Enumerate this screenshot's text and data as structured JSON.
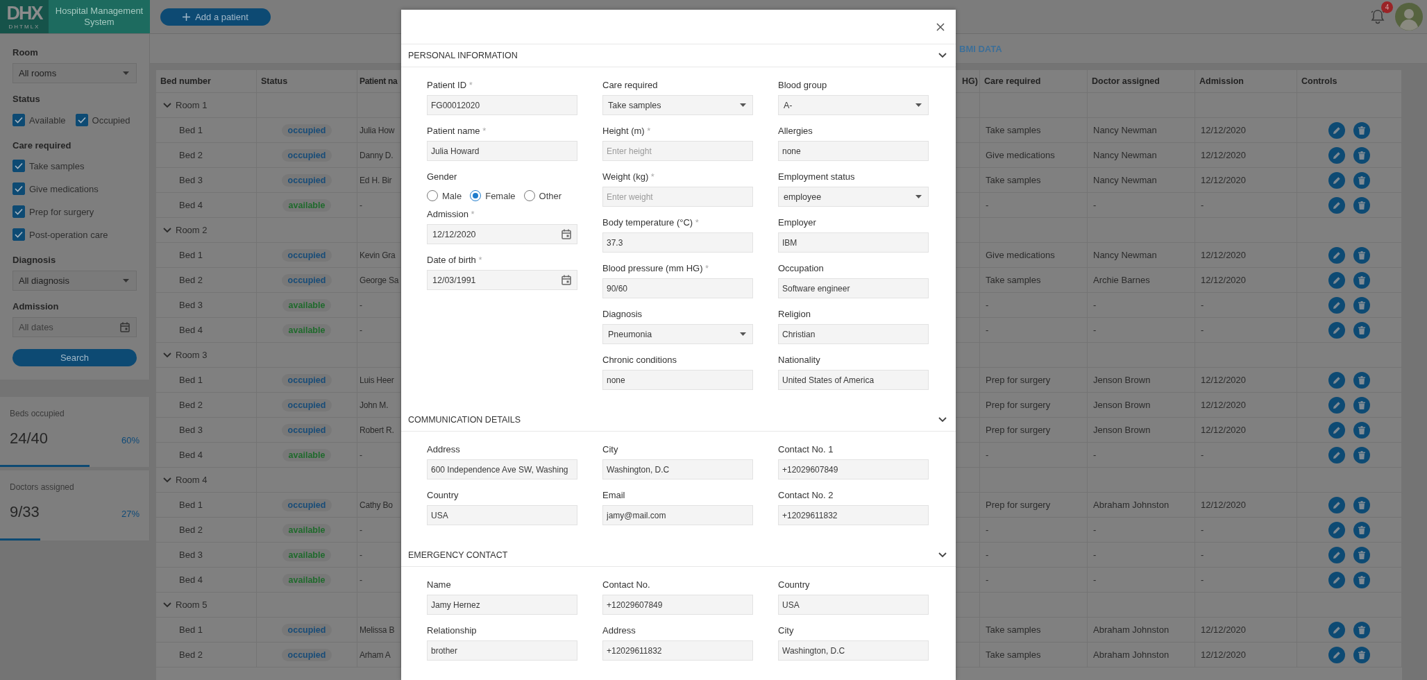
{
  "header": {
    "logo": "DHX",
    "logo_sub": "DHTMLX",
    "title": "Hospital Management System",
    "add_button": "Add a patient",
    "notification_count": "4"
  },
  "sidebar": {
    "room": {
      "label": "Room",
      "value": "All rooms"
    },
    "status": {
      "label": "Status",
      "options": [
        {
          "label": "Available",
          "checked": true
        },
        {
          "label": "Occupied",
          "checked": true
        }
      ]
    },
    "care": {
      "label": "Care required",
      "options": [
        {
          "label": "Take samples",
          "checked": true
        },
        {
          "label": "Give medications",
          "checked": true
        },
        {
          "label": "Prep for surgery",
          "checked": true
        },
        {
          "label": "Post-operation care",
          "checked": true
        }
      ]
    },
    "diagnosis": {
      "label": "Diagnosis",
      "value": "All diagnosis"
    },
    "admission": {
      "label": "Admission",
      "placeholder": "All dates"
    },
    "search_button": "Search"
  },
  "stats": [
    {
      "label": "Beds occupied",
      "value": "24/40",
      "percent": "60%",
      "level": 0.6
    },
    {
      "label": "Doctors assigned",
      "value": "9/33",
      "percent": "27%",
      "level": 0.27
    }
  ],
  "tabs": [
    {
      "label": "BMI DATA",
      "selected": false
    }
  ],
  "table": {
    "columns": [
      "Bed number",
      "Status",
      "Patient na",
      "HG)",
      "Care required",
      "Doctor assigned",
      "Admission",
      "Controls"
    ],
    "rooms": [
      {
        "name": "Room 1",
        "expanded": true,
        "children": [
          {
            "bed": "Bed 1",
            "status": "occupied",
            "color": "#184c78",
            "patient": "Julia How",
            "care": "Take samples",
            "doctor": "Nancy Newman",
            "admission": "12/12/2020"
          },
          {
            "bed": "Bed 2",
            "status": "occupied",
            "color": "#184c78",
            "patient": "Danny D.",
            "care": "Give medications",
            "doctor": "Nancy Newman",
            "admission": "12/12/2020"
          },
          {
            "bed": "Bed 3",
            "status": "occupied",
            "color": "#184c78",
            "patient": "Ed H. Bir",
            "care": "Take samples",
            "doctor": "Nancy Newman",
            "admission": "12/12/2020"
          },
          {
            "bed": "Bed 4",
            "status": "available",
            "color": "#1f6a2c",
            "patient": "-",
            "care": "-",
            "doctor": "-",
            "admission": "-"
          }
        ]
      },
      {
        "name": "Room 2",
        "expanded": true,
        "children": [
          {
            "bed": "Bed 1",
            "status": "occupied",
            "color": "#184c78",
            "patient": "Kevin Gra",
            "care": "Give medications",
            "doctor": "Nancy Newman",
            "admission": "12/12/2020"
          },
          {
            "bed": "Bed 2",
            "status": "occupied",
            "color": "#184c78",
            "patient": "George Sa",
            "care": "Take samples",
            "doctor": "Archie Barnes",
            "admission": "12/12/2020"
          },
          {
            "bed": "Bed 3",
            "status": "available",
            "color": "#1f6a2c",
            "patient": "-",
            "care": "-",
            "doctor": "-",
            "admission": "-"
          },
          {
            "bed": "Bed 4",
            "status": "available",
            "color": "#1f6a2c",
            "patient": "-",
            "care": "-",
            "doctor": "-",
            "admission": "-"
          }
        ]
      },
      {
        "name": "Room 3",
        "expanded": true,
        "children": [
          {
            "bed": "Bed 1",
            "status": "occupied",
            "color": "#184c78",
            "patient": "Luis Heer",
            "care": "Prep for surgery",
            "doctor": "Jenson Brown",
            "admission": "12/12/2020"
          },
          {
            "bed": "Bed 2",
            "status": "occupied",
            "color": "#184c78",
            "patient": "John M.",
            "care": "Prep for surgery",
            "doctor": "Jenson Brown",
            "admission": "12/12/2020"
          },
          {
            "bed": "Bed 3",
            "status": "occupied",
            "color": "#184c78",
            "patient": "Robert R.",
            "care": "Prep for surgery",
            "doctor": "Jenson Brown",
            "admission": "12/12/2020"
          },
          {
            "bed": "Bed 4",
            "status": "available",
            "color": "#1f6a2c",
            "patient": "-",
            "care": "-",
            "doctor": "-",
            "admission": "-"
          }
        ]
      },
      {
        "name": "Room 4",
        "expanded": true,
        "children": [
          {
            "bed": "Bed 1",
            "status": "occupied",
            "color": "#184c78",
            "patient": "Cathy Bo",
            "care": "Prep for surgery",
            "doctor": "Abraham Johnston",
            "admission": "12/12/2020"
          },
          {
            "bed": "Bed 2",
            "status": "available",
            "color": "#1f6a2c",
            "patient": "-",
            "care": "-",
            "doctor": "-",
            "admission": "-"
          },
          {
            "bed": "Bed 3",
            "status": "available",
            "color": "#1f6a2c",
            "patient": "-",
            "care": "-",
            "doctor": "-",
            "admission": "-"
          },
          {
            "bed": "Bed 4",
            "status": "available",
            "color": "#1f6a2c",
            "patient": "-",
            "care": "-",
            "doctor": "-",
            "admission": "-"
          }
        ]
      },
      {
        "name": "Room 5",
        "expanded": true,
        "children": [
          {
            "bed": "Bed 1",
            "status": "occupied",
            "color": "#184c78",
            "patient": "Melissa B",
            "care": "Take samples",
            "doctor": "Abraham Johnston",
            "admission": "12/12/2020"
          },
          {
            "bed": "Bed 2",
            "status": "occupied",
            "color": "#184c78",
            "patient": "Arham A",
            "care": "Take samples",
            "doctor": "Abraham Johnston",
            "admission": "12/12/2020"
          }
        ]
      }
    ]
  },
  "modal": {
    "sections": [
      {
        "title": "PERSONAL INFORMATION",
        "expanded": true,
        "columns": [
          [
            {
              "kind": "text",
              "label": "Patient ID",
              "mark": "*",
              "value": "FG00012020"
            },
            {
              "kind": "text",
              "label": "Patient name",
              "mark": "*",
              "value": "Julia Howard"
            },
            {
              "kind": "radio",
              "label": "Gender",
              "options": [
                {
                  "label": "Male",
                  "selected": false
                },
                {
                  "label": "Female",
                  "selected": true
                },
                {
                  "label": "Other",
                  "selected": false
                }
              ]
            },
            {
              "kind": "date",
              "label": "Admission",
              "mark": "*",
              "value": "12/12/2020"
            },
            {
              "kind": "date",
              "label": "Date of birth",
              "mark": "*",
              "value": "12/03/1991"
            }
          ],
          [
            {
              "kind": "select",
              "label": "Care required",
              "value": "Take samples"
            },
            {
              "kind": "text",
              "label": "Height (m)",
              "mark": "*",
              "placeholder": "Enter height"
            },
            {
              "kind": "text",
              "label": "Weight (kg)",
              "mark": "*",
              "placeholder": "Enter weight"
            },
            {
              "kind": "text",
              "label": "Body temperature (°C)",
              "mark": "*",
              "value": "37.3"
            },
            {
              "kind": "text",
              "label": "Blood pressure (mm HG)",
              "mark": "*",
              "value": "90/60"
            },
            {
              "kind": "select",
              "label": "Diagnosis",
              "value": "Pneumonia"
            },
            {
              "kind": "text",
              "label": "Chronic conditions",
              "value": "none"
            }
          ],
          [
            {
              "kind": "select",
              "label": "Blood group",
              "value": "A-"
            },
            {
              "kind": "text",
              "label": "Allergies",
              "value": "none"
            },
            {
              "kind": "select",
              "label": "Employment status",
              "value": "employee"
            },
            {
              "kind": "text",
              "label": "Employer",
              "value": "IBM"
            },
            {
              "kind": "text",
              "label": "Occupation",
              "value": "Software engineer"
            },
            {
              "kind": "text",
              "label": "Religion",
              "value": "Christian"
            },
            {
              "kind": "text",
              "label": "Nationality",
              "value": "United States of America"
            }
          ]
        ]
      },
      {
        "title": "COMMUNICATION DETAILS",
        "expanded": true,
        "columns": [
          [
            {
              "kind": "text",
              "label": "Address",
              "value": "600 Independence Ave SW, Washing"
            },
            {
              "kind": "text",
              "label": "Country",
              "value": "USA"
            }
          ],
          [
            {
              "kind": "text",
              "label": "City",
              "value": "Washington, D.C"
            },
            {
              "kind": "text",
              "label": "Email",
              "value": "jamy@mail.com"
            }
          ],
          [
            {
              "kind": "text",
              "label": "Contact No. 1",
              "value": "+12029607849"
            },
            {
              "kind": "text",
              "label": "Contact No. 2",
              "value": "+12029611832"
            }
          ]
        ]
      },
      {
        "title": "EMERGENCY CONTACT",
        "expanded": true,
        "columns": [
          [
            {
              "kind": "text",
              "label": "Name",
              "value": "Jamy Hernez"
            },
            {
              "kind": "text",
              "label": "Relationship",
              "value": "brother"
            }
          ],
          [
            {
              "kind": "text",
              "label": "Contact No.",
              "value": "+12029607849"
            },
            {
              "kind": "text",
              "label": "Address",
              "value": "+12029611832"
            }
          ],
          [
            {
              "kind": "text",
              "label": "Country",
              "value": "USA"
            },
            {
              "kind": "text",
              "label": "City",
              "value": "Washington, D.C"
            }
          ]
        ]
      }
    ]
  }
}
